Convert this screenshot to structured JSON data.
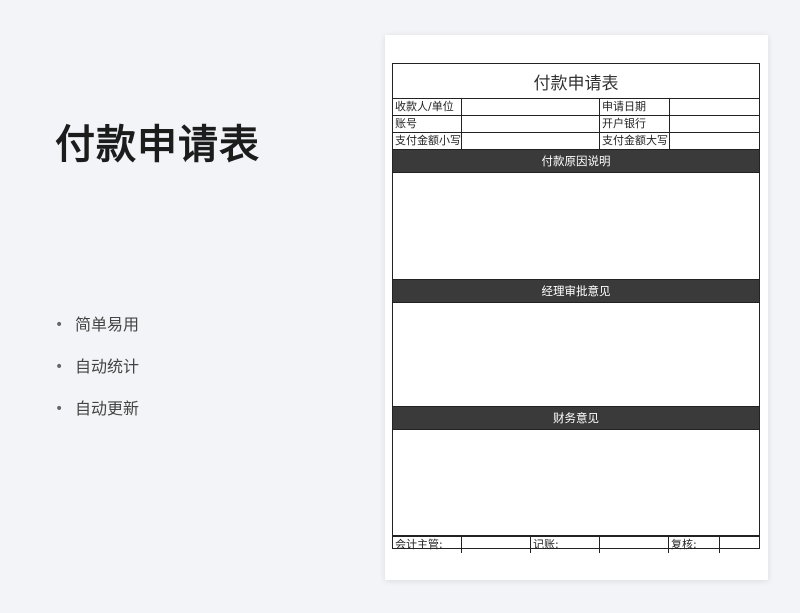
{
  "title": "付款申请表",
  "features": [
    "简单易用",
    "自动统计",
    "自动更新"
  ],
  "form": {
    "header": "付款申请表",
    "info_rows": [
      {
        "left_label": "收款人/单位",
        "right_label": "申请日期"
      },
      {
        "left_label": "账号",
        "right_label": "开户银行"
      },
      {
        "left_label": "支付金额小写",
        "right_label": "支付金额大写"
      }
    ],
    "sections": [
      "付款原因说明",
      "经理审批意见",
      "财务意见"
    ],
    "sign": {
      "supervisor": "会计主管:",
      "bookkeeper": "记账:",
      "reviewer": "复核:"
    }
  }
}
